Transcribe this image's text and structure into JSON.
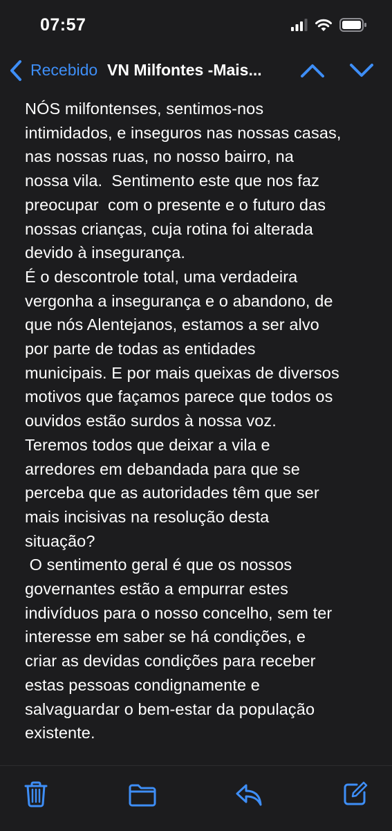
{
  "status_bar": {
    "time": "07:57",
    "icons": [
      "cellular-signal-icon",
      "wifi-icon",
      "battery-icon"
    ]
  },
  "nav": {
    "back_label": "Recebido",
    "title": "VN Milfontes -Mais...",
    "icons": [
      "back-chevron-icon",
      "chevron-up-icon",
      "chevron-down-icon"
    ]
  },
  "message": {
    "lines": [
      "NÓS milfontenses, sentimos-nos",
      "intimidados, e inseguros nas nossas casas,",
      "nas nossas ruas, no nosso bairro, na",
      "nossa vila.  Sentimento este que nos faz",
      "preocupar  com o presente e o futuro das",
      "nossas crianças, cuja rotina foi alterada",
      "devido à insegurança.",
      "É o descontrole total, uma verdadeira",
      "vergonha a insegurança e o abandono, de",
      "que nós Alentejanos, estamos a ser alvo",
      "por parte de todas as entidades",
      "municipais. E por mais queixas de diversos",
      "motivos que façamos parece que todos os",
      "ouvidos estão surdos à nossa voz.",
      "Teremos todos que deixar a vila e",
      "arredores em debandada para que se",
      "perceba que as autoridades têm que ser",
      "mais incisivas na resolução desta",
      "situação?",
      " O sentimento geral é que os nossos",
      "governantes estão a empurrar estes",
      "indivíduos para o nosso concelho, sem ter",
      "interesse em saber se há condições, e",
      "criar as devidas condições para receber",
      "estas pessoas condignamente e",
      "salvaguardar o bem-estar da população",
      "existente."
    ]
  },
  "toolbar": {
    "icons": [
      "trash-icon",
      "folder-icon",
      "reply-icon",
      "compose-icon"
    ]
  },
  "colors": {
    "background": "#1c1c1e",
    "accent": "#3e8ef7",
    "text": "#ffffff"
  }
}
